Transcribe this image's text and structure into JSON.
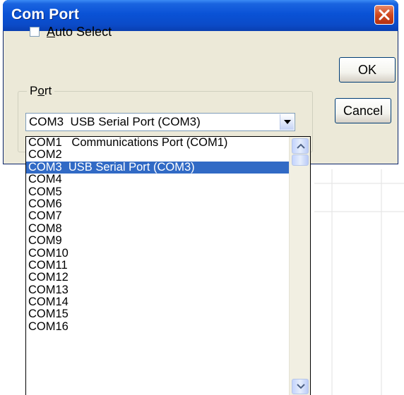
{
  "dialog": {
    "title": "Com Port",
    "close_icon": "close-x-icon",
    "auto_select_label": "Auto Select",
    "auto_select_checked": false,
    "group_label": "Port",
    "ok_label": "OK",
    "cancel_label": "Cancel"
  },
  "combo": {
    "selected_value": "COM3  USB Serial Port (COM3)",
    "arrow_icon": "chevron-down-icon"
  },
  "dropdown": {
    "items": [
      "COM1   Communications Port (COM1)",
      "COM2",
      "COM3  USB Serial Port (COM3)",
      "COM4",
      "COM5",
      "COM6",
      "COM7",
      "COM8",
      "COM9",
      "COM10",
      "COM11",
      "COM12",
      "COM13",
      "COM14",
      "COM15",
      "COM16"
    ],
    "selected_index": 2
  },
  "colors": {
    "titlebar": "#0a52d6",
    "selection": "#316ac5",
    "dialog_bg": "#ece9d8"
  }
}
